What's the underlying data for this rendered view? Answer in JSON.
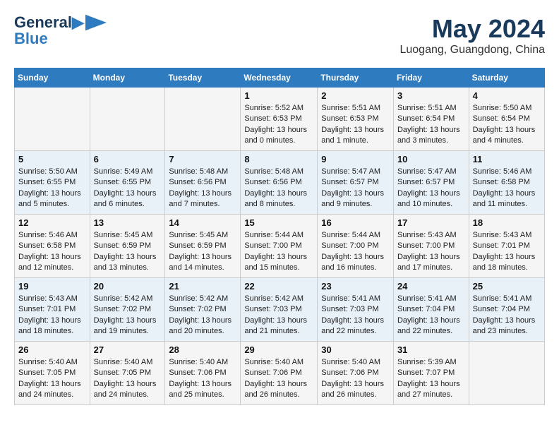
{
  "header": {
    "logo_line1": "General",
    "logo_line2": "Blue",
    "month": "May 2024",
    "location": "Luogang, Guangdong, China"
  },
  "weekdays": [
    "Sunday",
    "Monday",
    "Tuesday",
    "Wednesday",
    "Thursday",
    "Friday",
    "Saturday"
  ],
  "weeks": [
    [
      {
        "day": "",
        "info": ""
      },
      {
        "day": "",
        "info": ""
      },
      {
        "day": "",
        "info": ""
      },
      {
        "day": "1",
        "info": "Sunrise: 5:52 AM\nSunset: 6:53 PM\nDaylight: 13 hours\nand 0 minutes."
      },
      {
        "day": "2",
        "info": "Sunrise: 5:51 AM\nSunset: 6:53 PM\nDaylight: 13 hours\nand 1 minute."
      },
      {
        "day": "3",
        "info": "Sunrise: 5:51 AM\nSunset: 6:54 PM\nDaylight: 13 hours\nand 3 minutes."
      },
      {
        "day": "4",
        "info": "Sunrise: 5:50 AM\nSunset: 6:54 PM\nDaylight: 13 hours\nand 4 minutes."
      }
    ],
    [
      {
        "day": "5",
        "info": "Sunrise: 5:50 AM\nSunset: 6:55 PM\nDaylight: 13 hours\nand 5 minutes."
      },
      {
        "day": "6",
        "info": "Sunrise: 5:49 AM\nSunset: 6:55 PM\nDaylight: 13 hours\nand 6 minutes."
      },
      {
        "day": "7",
        "info": "Sunrise: 5:48 AM\nSunset: 6:56 PM\nDaylight: 13 hours\nand 7 minutes."
      },
      {
        "day": "8",
        "info": "Sunrise: 5:48 AM\nSunset: 6:56 PM\nDaylight: 13 hours\nand 8 minutes."
      },
      {
        "day": "9",
        "info": "Sunrise: 5:47 AM\nSunset: 6:57 PM\nDaylight: 13 hours\nand 9 minutes."
      },
      {
        "day": "10",
        "info": "Sunrise: 5:47 AM\nSunset: 6:57 PM\nDaylight: 13 hours\nand 10 minutes."
      },
      {
        "day": "11",
        "info": "Sunrise: 5:46 AM\nSunset: 6:58 PM\nDaylight: 13 hours\nand 11 minutes."
      }
    ],
    [
      {
        "day": "12",
        "info": "Sunrise: 5:46 AM\nSunset: 6:58 PM\nDaylight: 13 hours\nand 12 minutes."
      },
      {
        "day": "13",
        "info": "Sunrise: 5:45 AM\nSunset: 6:59 PM\nDaylight: 13 hours\nand 13 minutes."
      },
      {
        "day": "14",
        "info": "Sunrise: 5:45 AM\nSunset: 6:59 PM\nDaylight: 13 hours\nand 14 minutes."
      },
      {
        "day": "15",
        "info": "Sunrise: 5:44 AM\nSunset: 7:00 PM\nDaylight: 13 hours\nand 15 minutes."
      },
      {
        "day": "16",
        "info": "Sunrise: 5:44 AM\nSunset: 7:00 PM\nDaylight: 13 hours\nand 16 minutes."
      },
      {
        "day": "17",
        "info": "Sunrise: 5:43 AM\nSunset: 7:00 PM\nDaylight: 13 hours\nand 17 minutes."
      },
      {
        "day": "18",
        "info": "Sunrise: 5:43 AM\nSunset: 7:01 PM\nDaylight: 13 hours\nand 18 minutes."
      }
    ],
    [
      {
        "day": "19",
        "info": "Sunrise: 5:43 AM\nSunset: 7:01 PM\nDaylight: 13 hours\nand 18 minutes."
      },
      {
        "day": "20",
        "info": "Sunrise: 5:42 AM\nSunset: 7:02 PM\nDaylight: 13 hours\nand 19 minutes."
      },
      {
        "day": "21",
        "info": "Sunrise: 5:42 AM\nSunset: 7:02 PM\nDaylight: 13 hours\nand 20 minutes."
      },
      {
        "day": "22",
        "info": "Sunrise: 5:42 AM\nSunset: 7:03 PM\nDaylight: 13 hours\nand 21 minutes."
      },
      {
        "day": "23",
        "info": "Sunrise: 5:41 AM\nSunset: 7:03 PM\nDaylight: 13 hours\nand 22 minutes."
      },
      {
        "day": "24",
        "info": "Sunrise: 5:41 AM\nSunset: 7:04 PM\nDaylight: 13 hours\nand 22 minutes."
      },
      {
        "day": "25",
        "info": "Sunrise: 5:41 AM\nSunset: 7:04 PM\nDaylight: 13 hours\nand 23 minutes."
      }
    ],
    [
      {
        "day": "26",
        "info": "Sunrise: 5:40 AM\nSunset: 7:05 PM\nDaylight: 13 hours\nand 24 minutes."
      },
      {
        "day": "27",
        "info": "Sunrise: 5:40 AM\nSunset: 7:05 PM\nDaylight: 13 hours\nand 24 minutes."
      },
      {
        "day": "28",
        "info": "Sunrise: 5:40 AM\nSunset: 7:06 PM\nDaylight: 13 hours\nand 25 minutes."
      },
      {
        "day": "29",
        "info": "Sunrise: 5:40 AM\nSunset: 7:06 PM\nDaylight: 13 hours\nand 26 minutes."
      },
      {
        "day": "30",
        "info": "Sunrise: 5:40 AM\nSunset: 7:06 PM\nDaylight: 13 hours\nand 26 minutes."
      },
      {
        "day": "31",
        "info": "Sunrise: 5:39 AM\nSunset: 7:07 PM\nDaylight: 13 hours\nand 27 minutes."
      },
      {
        "day": "",
        "info": ""
      }
    ]
  ]
}
